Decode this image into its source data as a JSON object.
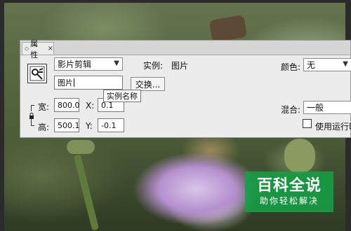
{
  "panel": {
    "tab_label": "属性",
    "tab_close": "×",
    "symbol_type": "影片剪辑",
    "instance_label": "实例:",
    "instance_value": "图片",
    "instance_name_value": "图片",
    "swap_button": "交换...",
    "tooltip": "实例名称",
    "width_label": "宽:",
    "width_value": "800.0",
    "height_label": "高:",
    "height_value": "500.1",
    "x_label": "X:",
    "x_value": "0.1",
    "y_label": "Y:",
    "y_value": "-0.1",
    "color_label": "颜色:",
    "color_value": "无",
    "blend_label": "混合:",
    "blend_value": "一般",
    "runtime_checkbox_label": "使用运行时"
  },
  "watermark": {
    "title": "百科全说",
    "subtitle": "助你轻松解决"
  }
}
